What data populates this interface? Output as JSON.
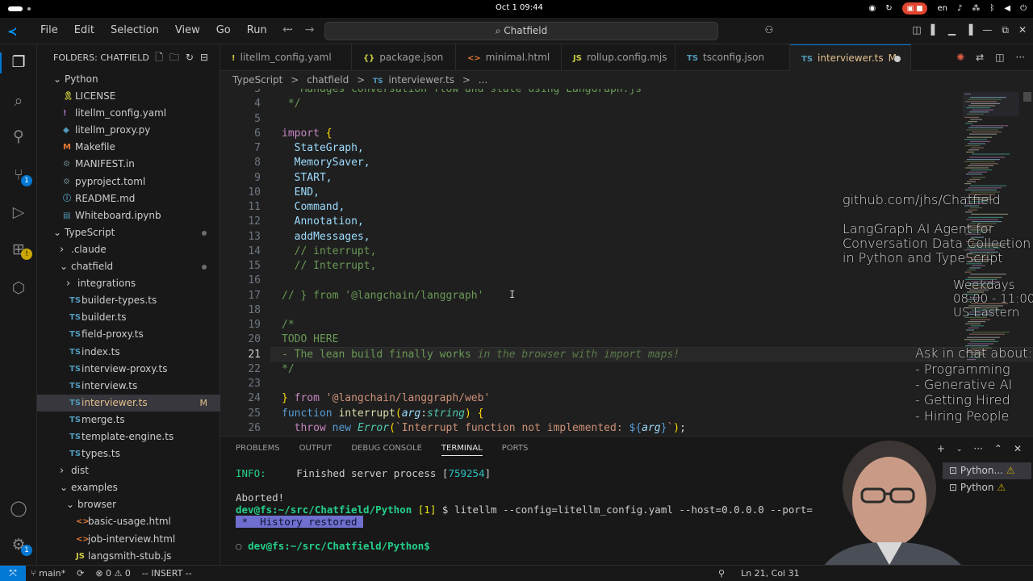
{
  "topbar": {
    "clock": "Oct 1  09:44",
    "lang": "en"
  },
  "titlebar": {
    "menus": [
      "File",
      "Edit",
      "Selection",
      "View",
      "Go",
      "Run",
      "···"
    ],
    "command_center": "Chatfield"
  },
  "sidebar": {
    "title": "FOLDERS: CHATFIELD",
    "items": [
      {
        "label": "Python",
        "icon": "chevron-down-icon",
        "indent": 0
      },
      {
        "label": "LICENSE",
        "icon": "license-icon",
        "indent": 1
      },
      {
        "label": "litellm_config.yaml",
        "icon": "yaml-icon",
        "indent": 1
      },
      {
        "label": "litellm_proxy.py",
        "icon": "python-icon",
        "indent": 1
      },
      {
        "label": "Makefile",
        "icon": "makefile-icon",
        "indent": 1
      },
      {
        "label": "MANIFEST.in",
        "icon": "manifest-icon",
        "indent": 1
      },
      {
        "label": "pyproject.toml",
        "icon": "toml-icon",
        "indent": 1
      },
      {
        "label": "README.md",
        "icon": "markdown-icon",
        "indent": 1
      },
      {
        "label": "Whiteboard.ipynb",
        "icon": "notebook-icon",
        "indent": 1
      },
      {
        "label": "TypeScript",
        "icon": "chevron-down-icon",
        "indent": 0
      },
      {
        "label": ".claude",
        "icon": "chevron-right-icon",
        "indent": 1
      },
      {
        "label": "chatfield",
        "icon": "chevron-down-icon",
        "indent": 1
      },
      {
        "label": "integrations",
        "icon": "chevron-right-icon",
        "indent": 2
      },
      {
        "label": "builder-types.ts",
        "icon": "ts-icon",
        "indent": 2
      },
      {
        "label": "builder.ts",
        "icon": "ts-icon",
        "indent": 2
      },
      {
        "label": "field-proxy.ts",
        "icon": "ts-icon",
        "indent": 2
      },
      {
        "label": "index.ts",
        "icon": "ts-icon",
        "indent": 2
      },
      {
        "label": "interview-proxy.ts",
        "icon": "ts-icon",
        "indent": 2
      },
      {
        "label": "interview.ts",
        "icon": "ts-icon",
        "indent": 2
      },
      {
        "label": "interviewer.ts",
        "icon": "ts-icon",
        "indent": 2,
        "status": "M"
      },
      {
        "label": "merge.ts",
        "icon": "ts-icon",
        "indent": 2
      },
      {
        "label": "template-engine.ts",
        "icon": "ts-icon",
        "indent": 2
      },
      {
        "label": "types.ts",
        "icon": "ts-icon",
        "indent": 2
      },
      {
        "label": "dist",
        "icon": "chevron-right-icon",
        "indent": 1
      },
      {
        "label": "examples",
        "icon": "chevron-down-icon",
        "indent": 1
      },
      {
        "label": "browser",
        "icon": "chevron-down-icon",
        "indent": 2
      },
      {
        "label": "basic-usage.html",
        "icon": "html-icon",
        "indent": 3
      },
      {
        "label": "job-interview.html",
        "icon": "html-icon",
        "indent": 3
      },
      {
        "label": "langsmith-stub.js",
        "icon": "js-icon",
        "indent": 3
      }
    ]
  },
  "tabs": [
    {
      "label": "litellm_config.yaml",
      "icon": "!",
      "color": "#cbcb41"
    },
    {
      "label": "package.json",
      "icon": "{}",
      "color": "#cbcb41"
    },
    {
      "label": "minimal.html",
      "icon": "<>",
      "color": "#e37933"
    },
    {
      "label": "rollup.config.mjs",
      "icon": "JS",
      "color": "#cbcb41"
    },
    {
      "label": "tsconfig.json",
      "icon": "TS",
      "color": "#519aba"
    },
    {
      "label": "interviewer.ts",
      "icon": "TS",
      "color": "#519aba",
      "status": "M",
      "active": true
    }
  ],
  "breadcrumb": [
    "TypeScript",
    ">",
    "chatfield",
    ">",
    "TS",
    "interviewer.ts",
    ">",
    "..."
  ],
  "editor": {
    "cursor_line": 21,
    "lines": [
      {
        "n": "3",
        "code": " * Manages conversation flow and state using LangGraph.js"
      },
      {
        "n": "4",
        "code": " */"
      },
      {
        "n": "5",
        "code": ""
      },
      {
        "n": "6",
        "code": "import {"
      },
      {
        "n": "7",
        "code": "  StateGraph,"
      },
      {
        "n": "8",
        "code": "  MemorySaver,"
      },
      {
        "n": "9",
        "code": "  START,"
      },
      {
        "n": "10",
        "code": "  END,"
      },
      {
        "n": "11",
        "code": "  Command,"
      },
      {
        "n": "12",
        "code": "  Annotation,"
      },
      {
        "n": "13",
        "code": "  addMessages,"
      },
      {
        "n": "14",
        "code": "  // interrupt,"
      },
      {
        "n": "15",
        "code": "  // Interrupt,"
      },
      {
        "n": "16",
        "code": ""
      },
      {
        "n": "17",
        "code": "// } from '@langchain/langgraph'"
      },
      {
        "n": "18",
        "code": ""
      },
      {
        "n": "19",
        "code": "/*"
      },
      {
        "n": "20",
        "code": "TODO HERE"
      },
      {
        "n": "21",
        "code": "- The lean build finally works in the browser with import maps!"
      },
      {
        "n": "22",
        "code": "*/"
      },
      {
        "n": "23",
        "code": ""
      },
      {
        "n": "24",
        "code": "} from '@langchain/langgraph/web'"
      },
      {
        "n": "25",
        "code": "function interrupt(arg:string) {"
      },
      {
        "n": "26",
        "code": "  throw new Error(`Interrupt function not implemented: ${arg}`);"
      }
    ]
  },
  "overlay": {
    "url": "github.com/jhs/Chatfield",
    "desc": [
      "LangGraph AI Agent for",
      "Conversation Data Collection",
      "in Python and TypeScript"
    ],
    "schedule": [
      "Weekdays",
      "08:00 - 11:00",
      "US Eastern"
    ],
    "ask": [
      "Ask in chat about:",
      "- Programming",
      "- Generative AI",
      "- Getting Hired",
      "- Hiring People"
    ]
  },
  "panel": {
    "tabs": [
      "PROBLEMS",
      "OUTPUT",
      "DEBUG CONSOLE",
      "TERMINAL",
      "PORTS"
    ],
    "active_tab": "TERMINAL",
    "terminal": {
      "info_label": "INFO:",
      "info_text": "Finished server process [",
      "pid": "759254",
      "aborted": "Aborted!",
      "prompt": "dev@fs:~/src/Chatfield/Python",
      "job": "[1]",
      "command": "$ litellm --config=litellm_config.yaml --host=0.0.0.0 --port=",
      "star": " * ",
      "history": " History restored ",
      "prompt2": "dev@fs:~/src/Chatfield/Python$"
    },
    "terminals": [
      "Python...",
      "Python"
    ]
  },
  "statusbar": {
    "branch": "main*",
    "errors": "0",
    "warnings": "0",
    "mode": "-- INSERT --",
    "position": "Ln 21, Col 31"
  }
}
